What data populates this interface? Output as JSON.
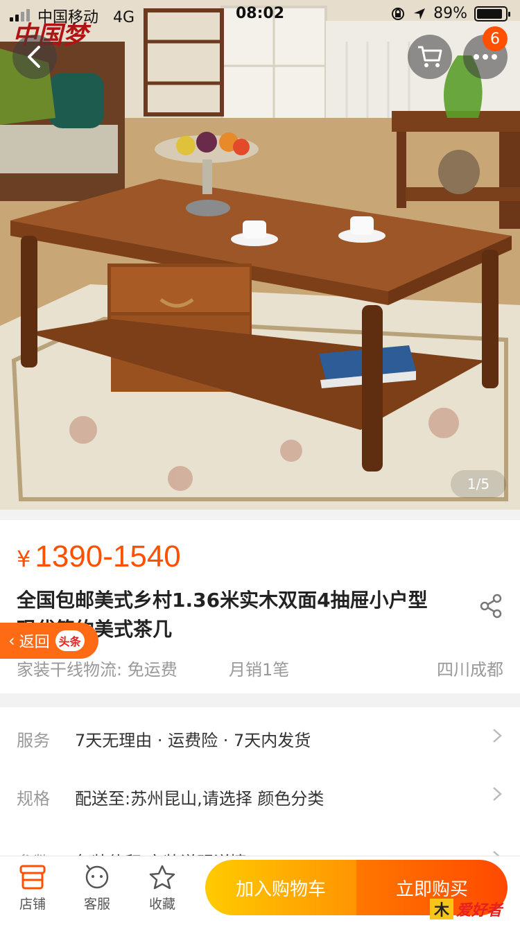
{
  "status_bar": {
    "carrier": "中国移动",
    "network": "4G",
    "time": "08:02",
    "battery": "89%",
    "battery_level": 0.89
  },
  "hero": {
    "watermark": "中国梦",
    "cart_badge": "6",
    "page_indicator": "1/5"
  },
  "product": {
    "currency": "¥",
    "price_range": "1390-1540",
    "title": "全国包邮美式乡村1.36米实木双面4抽屉小户型现代简约美式茶几",
    "shipping": "家装干线物流: 免运费",
    "monthly_sales": "月销1笔",
    "location": "四川成都"
  },
  "back_pill": {
    "label": "返回",
    "badge": "头条"
  },
  "options": [
    {
      "key": "服务",
      "value": "7天无理由 · 运费险 · 7天内发货"
    },
    {
      "key": "规格",
      "value": "配送至:苏州昆山,请选择 颜色分类"
    },
    {
      "key": "参数",
      "value": "包装体积 安装说明详情..."
    }
  ],
  "bottom_bar": {
    "store": "店铺",
    "service": "客服",
    "favorite": "收藏",
    "add_to_cart": "加入购物车",
    "buy_now": "立即购买"
  },
  "footer_watermark": "爱好者",
  "colors": {
    "accent": "#ff5000",
    "cart_gradient": [
      "#ffcb00",
      "#ff9402"
    ],
    "buy_gradient": [
      "#ff7700",
      "#ff4900"
    ],
    "back_pill": "#ff6a14"
  },
  "icons": {
    "back": "chevron-left-icon",
    "cart": "shopping-cart-icon",
    "more": "more-dots-icon",
    "share": "share-icon",
    "store": "store-icon",
    "service": "chat-face-icon",
    "favorite": "star-icon"
  }
}
